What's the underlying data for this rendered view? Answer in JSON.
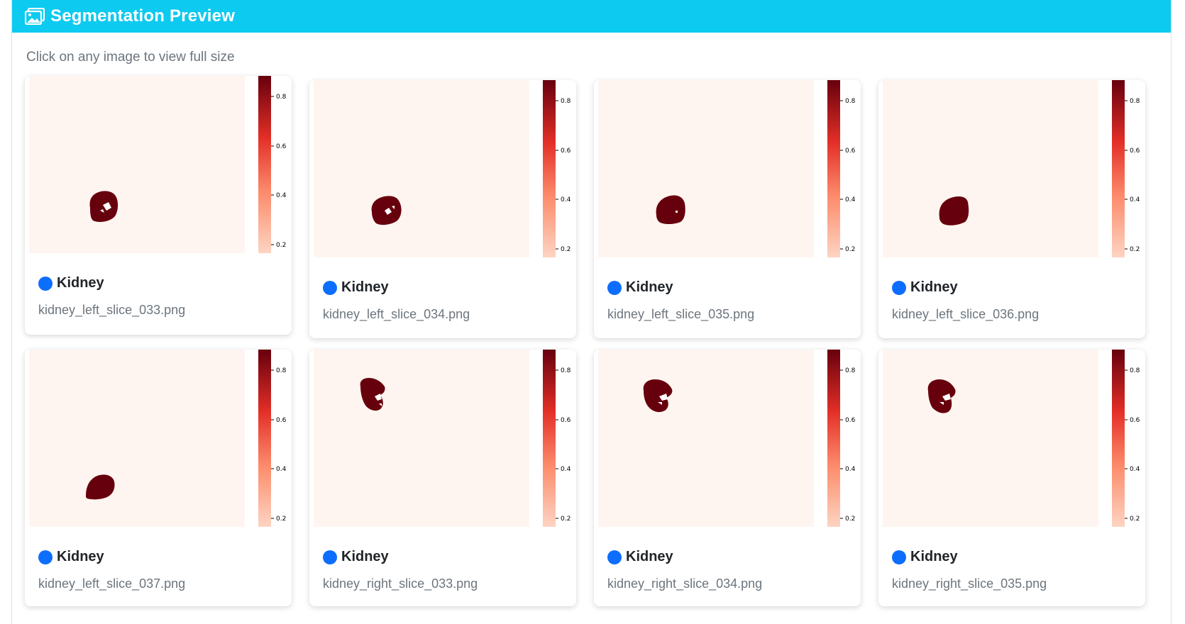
{
  "header": {
    "icon": "images-icon",
    "title": "Segmentation Preview",
    "color": "#0dcaf0"
  },
  "hint": "Click on any image to view full size",
  "colorbar": {
    "ticks": [
      "0.8",
      "0.6",
      "0.4",
      "0.2"
    ],
    "tick_values": [
      0.8,
      0.6,
      0.4,
      0.2
    ],
    "range": [
      0.12,
      0.88
    ],
    "colormap": "Reds"
  },
  "cards": [
    {
      "label": "Kidney",
      "filename": "kidney_left_slice_033.png",
      "dot_color": "#0d6efd"
    },
    {
      "label": "Kidney",
      "filename": "kidney_left_slice_034.png",
      "dot_color": "#0d6efd"
    },
    {
      "label": "Kidney",
      "filename": "kidney_left_slice_035.png",
      "dot_color": "#0d6efd"
    },
    {
      "label": "Kidney",
      "filename": "kidney_left_slice_036.png",
      "dot_color": "#0d6efd"
    },
    {
      "label": "Kidney",
      "filename": "kidney_left_slice_037.png",
      "dot_color": "#0d6efd"
    },
    {
      "label": "Kidney",
      "filename": "kidney_right_slice_033.png",
      "dot_color": "#0d6efd"
    },
    {
      "label": "Kidney",
      "filename": "kidney_right_slice_034.png",
      "dot_color": "#0d6efd"
    },
    {
      "label": "Kidney",
      "filename": "kidney_right_slice_035.png",
      "dot_color": "#0d6efd"
    }
  ]
}
